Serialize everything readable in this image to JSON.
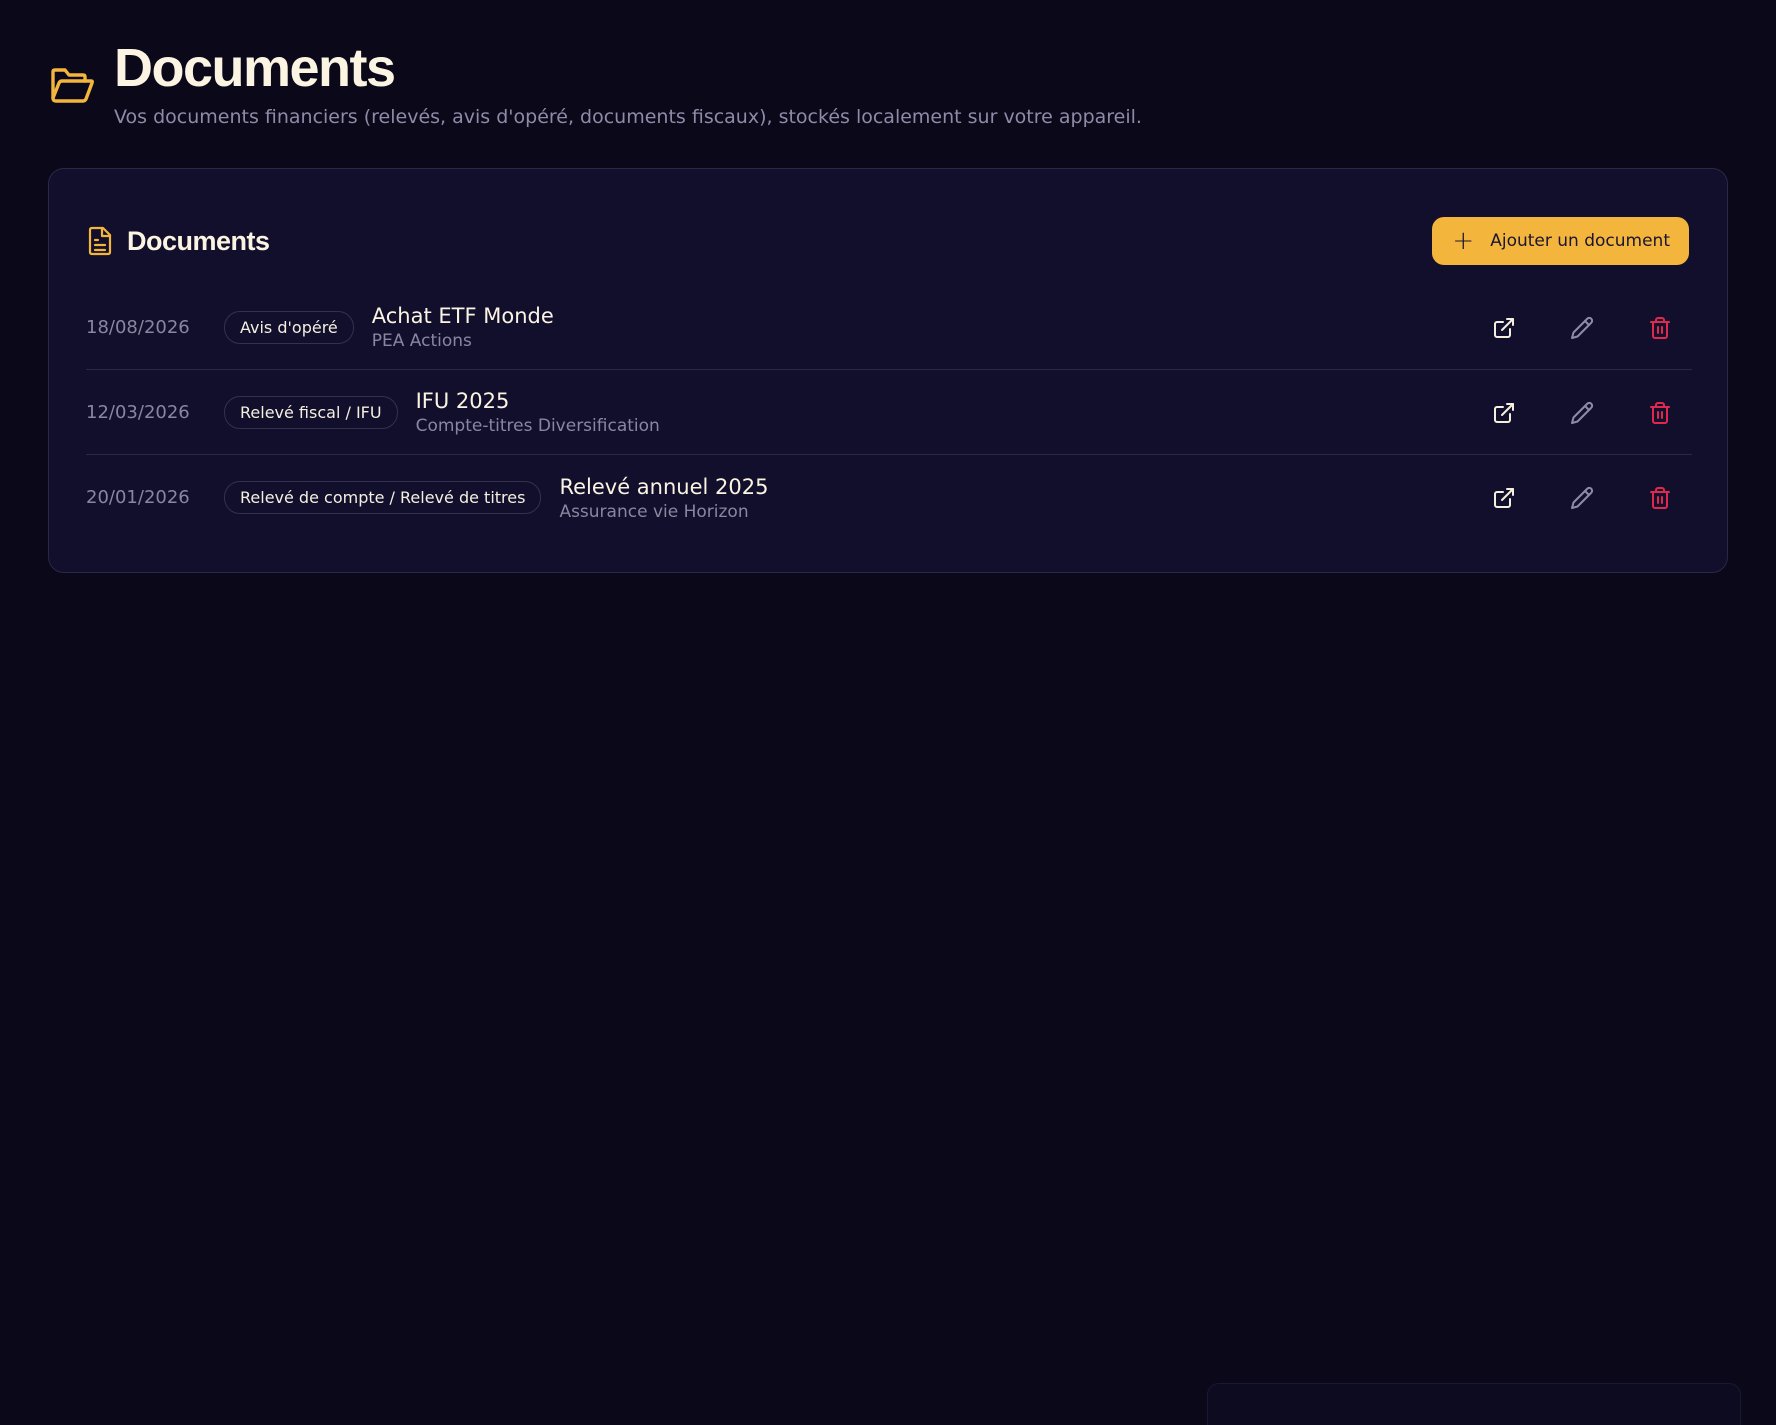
{
  "header": {
    "icon": "folder-open-icon",
    "title": "Documents",
    "subtitle": "Vos documents financiers (relevés, avis d'opéré, documents fiscaux), stockés localement sur votre appareil."
  },
  "card": {
    "icon": "document-icon",
    "title": "Documents",
    "add_button_label": "Ajouter un document",
    "add_button_icon": "plus-icon"
  },
  "documents": [
    {
      "date": "18/08/2026",
      "type": "Avis d'opéré",
      "name": "Achat ETF Monde",
      "account": "PEA Actions"
    },
    {
      "date": "12/03/2026",
      "type": "Relevé fiscal / IFU",
      "name": "IFU 2025",
      "account": "Compte-titres Diversification"
    },
    {
      "date": "20/01/2026",
      "type": "Relevé de compte / Relevé de titres",
      "name": "Relevé annuel 2025",
      "account": "Assurance vie Horizon"
    }
  ],
  "actions": {
    "open_icon": "external-link-icon",
    "edit_icon": "pencil-icon",
    "delete_icon": "trash-icon"
  },
  "colors": {
    "accent": "#f4b53c",
    "background": "#0a0819",
    "card": "#120f2c",
    "danger": "#e0284f"
  }
}
